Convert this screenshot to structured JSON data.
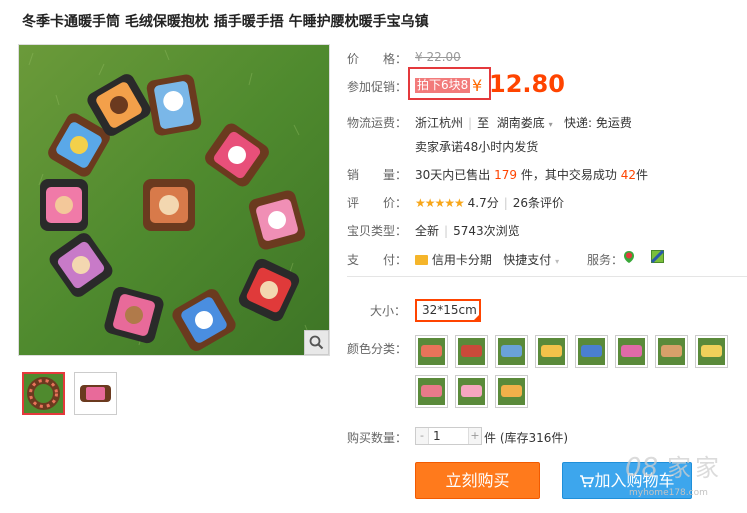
{
  "product": {
    "title": "冬季卡通暖手筒 毛绒保暖抱枕 插手暖手捂 午睡护腰枕暖手宝乌镇"
  },
  "price": {
    "label": "价　　格：",
    "original": "¥ 22.00",
    "promo_label": "参加促销：",
    "promo_tag": "拍下6块8",
    "currency": "¥",
    "current": "12.80"
  },
  "shipping": {
    "label": "物流运费：",
    "from": "浙江杭州",
    "to_prefix": "至",
    "to": "湖南娄底",
    "express": "快递: 免运费",
    "promise": "卖家承诺48小时内发货"
  },
  "sales": {
    "label": "销　　量：",
    "prefix": "30天内已售出",
    "sold": "179",
    "mid": "件，其中交易成功",
    "success": "42",
    "suffix": "件"
  },
  "rating": {
    "label": "评　　价：",
    "stars": "★★★★★",
    "score": "4.7分",
    "reviews": "26条评价"
  },
  "type": {
    "label": "宝贝类型：",
    "condition": "全新",
    "views": "5743次浏览"
  },
  "payment": {
    "label": "支　　付：",
    "credit": "信用卡分期",
    "quick": "快捷支付",
    "service_label": "服务："
  },
  "size": {
    "label": "大小：",
    "selected": "32*15cm"
  },
  "color": {
    "label": "颜色分类：",
    "swatch_colors": [
      "#e8735a",
      "#c94a3a",
      "#6aa2d8",
      "#f3c24a",
      "#4a7fd0",
      "#e06aa8",
      "#d8a06a",
      "#f0d05a",
      "#e87a8a",
      "#f5a6c0",
      "#f2b04a"
    ]
  },
  "quantity": {
    "label": "购买数量：",
    "value": "1",
    "minus": "-",
    "plus": "+",
    "stock": "件 (库存316件)"
  },
  "actions": {
    "buy": "立刻购买",
    "cart": "加入购物车"
  },
  "watermark": {
    "url": "myhome178.com"
  },
  "colors": {
    "accent": "#ff4400",
    "buy_button": "#ff7a1c",
    "cart_button": "#3da6ed"
  }
}
